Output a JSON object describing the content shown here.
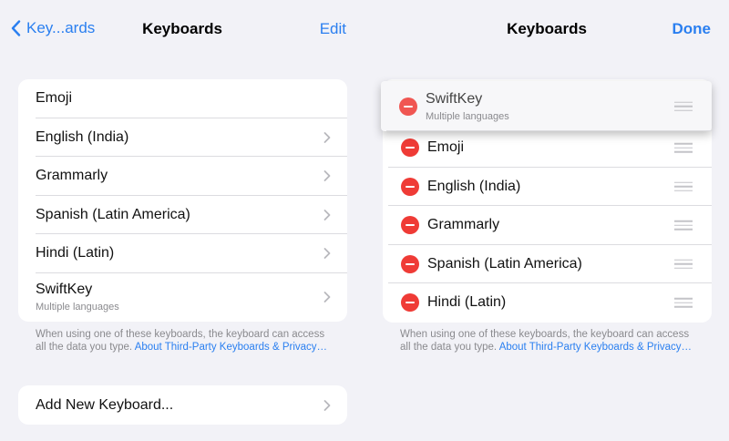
{
  "left": {
    "nav": {
      "back_label": "Key...ards",
      "title": "Keyboards",
      "edit_label": "Edit"
    },
    "keyboards": [
      {
        "name": "Emoji"
      },
      {
        "name": "English (India)"
      },
      {
        "name": "Grammarly"
      },
      {
        "name": "Spanish (Latin America)"
      },
      {
        "name": "Hindi (Latin)"
      },
      {
        "name": "SwiftKey",
        "sub": "Multiple languages"
      }
    ],
    "footnote": {
      "text": "When using one of these keyboards, the keyboard can access all the data you type. ",
      "link": "About Third-Party Keyboards & Privacy…"
    },
    "add_label": "Add New Keyboard..."
  },
  "right": {
    "nav": {
      "title": "Keyboards",
      "done_label": "Done"
    },
    "dragging": {
      "name": "SwiftKey",
      "sub": "Multiple languages"
    },
    "keyboards": [
      {
        "name": "Emoji"
      },
      {
        "name": "English (India)"
      },
      {
        "name": "Grammarly"
      },
      {
        "name": "Spanish (Latin America)"
      },
      {
        "name": "Hindi (Latin)"
      }
    ],
    "footnote": {
      "text": "When using one of these keyboards, the keyboard can access all the data you type. ",
      "link": "About Third-Party Keyboards & Privacy…"
    }
  },
  "colors": {
    "accent": "#2a7ff0",
    "delete": "#ef3b36",
    "background": "#f2f2f7"
  },
  "icons": {
    "back": "chevron-left-icon",
    "disclosure": "chevron-right-icon",
    "delete": "minus-circle-icon",
    "reorder": "reorder-grip-icon"
  }
}
